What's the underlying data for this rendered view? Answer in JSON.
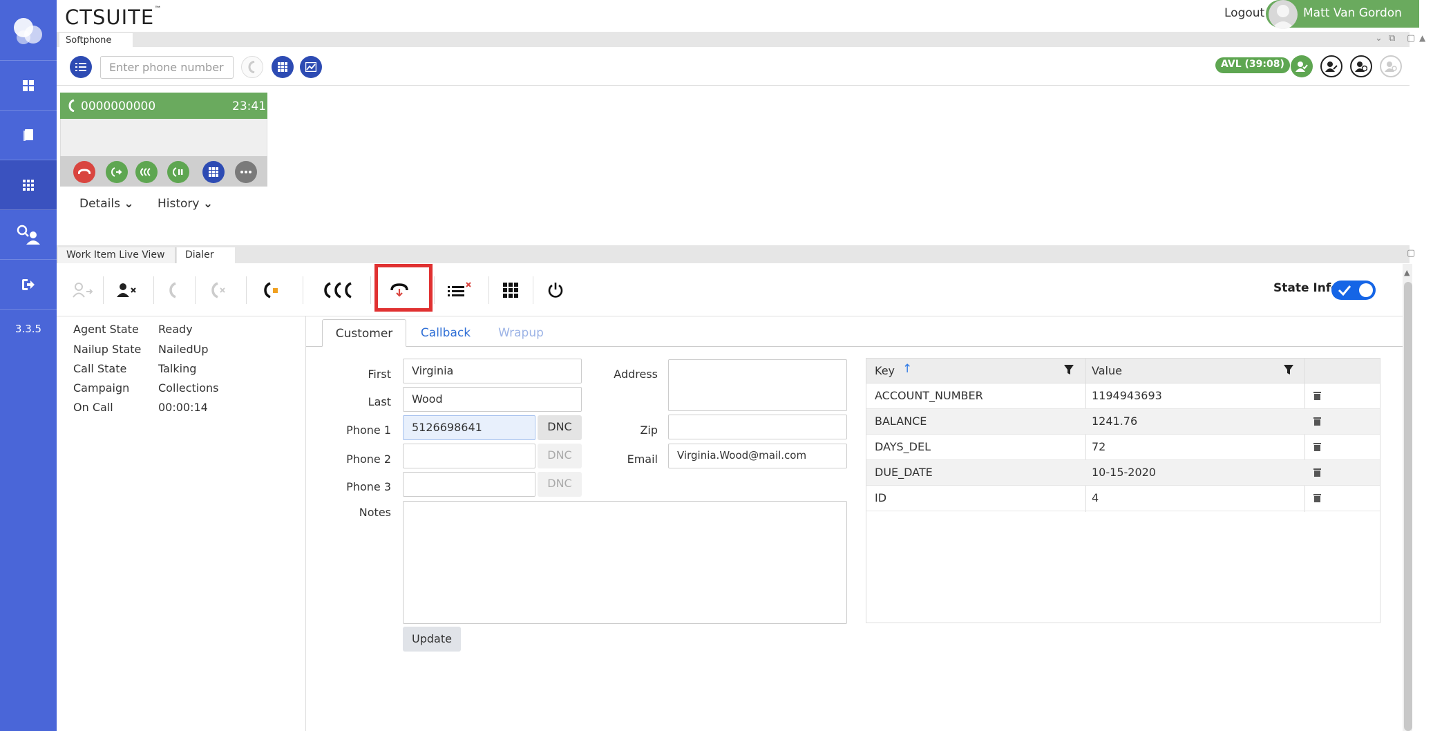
{
  "app": {
    "brand": "CTSUITE",
    "brand_mark": "™",
    "version": "3.3.5",
    "logout": "Logout",
    "user_name": "Matt Van Gordon"
  },
  "sidebar": {
    "items": [
      {
        "icon": "dashboard-icon"
      },
      {
        "icon": "book-icon"
      },
      {
        "icon": "dialpad-icon",
        "active": true
      },
      {
        "icon": "user-search-icon"
      },
      {
        "icon": "signout-icon"
      }
    ]
  },
  "softphone": {
    "tab": "Softphone",
    "phone_placeholder": "Enter phone number",
    "avl_badge": "AVL (39:08)",
    "call": {
      "number": "0000000000",
      "time": "23:41"
    },
    "details_label": "Details",
    "history_label": "History"
  },
  "lower_tabs": {
    "work_item": "Work Item Live View",
    "dialer": "Dialer"
  },
  "dialer": {
    "state_info_label": "State Info",
    "state_info_on": true,
    "state": [
      {
        "label": "Agent State",
        "value": "Ready"
      },
      {
        "label": "Nailup State",
        "value": "NailedUp"
      },
      {
        "label": "Call State",
        "value": "Talking"
      },
      {
        "label": "Campaign",
        "value": "Collections"
      },
      {
        "label": "On Call",
        "value": "00:00:14"
      }
    ],
    "tabs": {
      "customer": "Customer",
      "callback": "Callback",
      "wrapup": "Wrapup"
    },
    "form": {
      "first_label": "First",
      "first_value": "Virginia",
      "last_label": "Last",
      "last_value": "Wood",
      "phone1_label": "Phone 1",
      "phone1_value": "5126698641",
      "phone2_label": "Phone 2",
      "phone2_value": "",
      "phone3_label": "Phone 3",
      "phone3_value": "",
      "dnc_label": "DNC",
      "address_label": "Address",
      "address_value": "",
      "zip_label": "Zip",
      "zip_value": "",
      "email_label": "Email",
      "email_value": "Virginia.Wood@mail.com",
      "notes_label": "Notes",
      "notes_value": "",
      "update_label": "Update"
    },
    "kv_table": {
      "key_header": "Key",
      "value_header": "Value",
      "rows": [
        {
          "key": "ACCOUNT_NUMBER",
          "value": "1194943693"
        },
        {
          "key": "BALANCE",
          "value": "1241.76"
        },
        {
          "key": "DAYS_DEL",
          "value": "72"
        },
        {
          "key": "DUE_DATE",
          "value": "10-15-2020"
        },
        {
          "key": "ID",
          "value": "4"
        }
      ]
    }
  },
  "colors": {
    "sidebar": "#4a66d8",
    "green": "#6aaa5e",
    "red_highlight": "#e03131",
    "toggle_blue": "#1565e6",
    "icon_blue": "#2d4bb3"
  }
}
